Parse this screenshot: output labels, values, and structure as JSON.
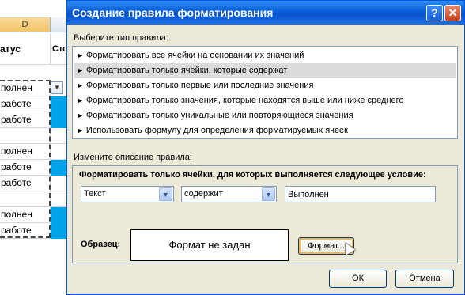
{
  "sheet": {
    "column_d": "D",
    "header_d": "атус",
    "header_e": "Сто",
    "rows": [
      {
        "text": "полнен",
        "blue": false,
        "dropdown": true
      },
      {
        "text": "работе",
        "blue": true
      },
      {
        "text": "работе",
        "blue": true
      },
      {
        "text": "",
        "blue": false
      },
      {
        "text": "полнен",
        "blue": false
      },
      {
        "text": "работе",
        "blue": true
      },
      {
        "text": "работе",
        "blue": false
      },
      {
        "text": "",
        "blue": false
      },
      {
        "text": "полнен",
        "blue": true
      },
      {
        "text": "работе",
        "blue": true
      }
    ]
  },
  "dialog": {
    "title": "Создание правила форматирования",
    "help_glyph": "?",
    "close_glyph": "✕",
    "rule_type_label": "Выберите тип правила:",
    "rule_types": [
      "Форматировать все ячейки на основании их значений",
      "Форматировать только ячейки, которые содержат",
      "Форматировать только первые или последние значения",
      "Форматировать только значения, которые находятся выше или ниже среднего",
      "Форматировать только уникальные или повторяющиеся значения",
      "Использовать формулу для определения форматируемых ячеек"
    ],
    "selected_rule_index": 1,
    "description_label": "Измените описание правила:",
    "condition_title": "Форматировать только ячейки, для которых выполняется следующее условие:",
    "condition": {
      "field_type": "Текст",
      "operator": "содержит",
      "value": "Выполнен"
    },
    "sample_label": "Образец:",
    "sample_text": "Формат не задан",
    "format_button": "Формат...",
    "ok_button": "ОК",
    "cancel_button": "Отмена"
  }
}
